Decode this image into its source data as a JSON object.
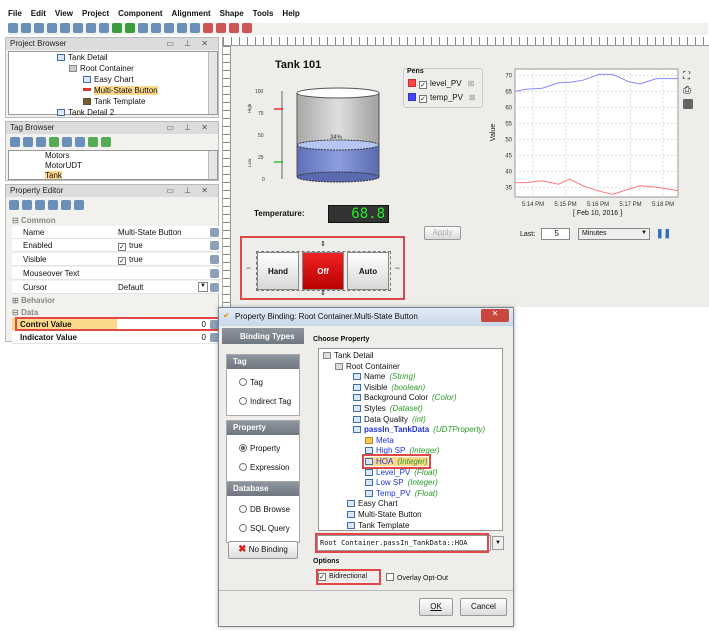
{
  "menu": [
    "File",
    "Edit",
    "View",
    "Project",
    "Component",
    "Alignment",
    "Shape",
    "Tools",
    "Help"
  ],
  "project_browser": {
    "title": "Project Browser",
    "items": [
      {
        "label": "Tank Detail"
      },
      {
        "label": "Root Container"
      },
      {
        "label": "Easy Chart"
      },
      {
        "label": "Multi-State Button",
        "selected": true
      },
      {
        "label": "Tank Template"
      },
      {
        "label": "Tank Detail 2"
      }
    ]
  },
  "tag_browser": {
    "title": "Tag Browser",
    "items": [
      {
        "label": "Motors"
      },
      {
        "label": "MotorUDT"
      },
      {
        "label": "Tank",
        "selected": true
      }
    ]
  },
  "property_editor": {
    "title": "Property Editor",
    "sections": {
      "common": "Common",
      "behavior": "Behavior",
      "data": "Data"
    },
    "rows": [
      {
        "name": "Name",
        "value": "Multi-State Button"
      },
      {
        "name": "Enabled",
        "value": "true"
      },
      {
        "name": "Visible",
        "value": "true"
      },
      {
        "name": "Mouseover Text",
        "value": ""
      },
      {
        "name": "Cursor",
        "value": "Default"
      }
    ],
    "data_rows": [
      {
        "name": "Control Value",
        "value": "0"
      },
      {
        "name": "Indicator Value",
        "value": "0"
      }
    ]
  },
  "designer": {
    "tank": {
      "title": "Tank 101",
      "level_label": "34%",
      "level_percent": 34,
      "scale": [
        "100",
        "75",
        "50",
        "25",
        "0"
      ],
      "high_label": "High",
      "low_label": "Low",
      "high_sp": 80,
      "low_sp": 20
    },
    "temperature": {
      "label": "Temperature:",
      "value": "68.8"
    },
    "apply_label": "Apply",
    "multi_state": {
      "buttons": [
        "Hand",
        "Off",
        "Auto"
      ],
      "active": "Off"
    },
    "pens": {
      "title": "Pens",
      "items": [
        {
          "name": "level_PV",
          "color": "#ff4444"
        },
        {
          "name": "temp_PV",
          "color": "#4444ff"
        }
      ]
    },
    "chart": {
      "ylabel": "Value",
      "yticks": [
        "70",
        "65",
        "60",
        "55",
        "50",
        "45",
        "40",
        "35"
      ],
      "xticks": [
        "5:14 PM",
        "5:15 PM",
        "5:16 PM",
        "5:17 PM",
        "5:18 PM"
      ],
      "date": "[ Feb 10, 2016 ]"
    },
    "last": {
      "label": "Last:",
      "value": "5",
      "unit": "Minutes"
    }
  },
  "chart_data": {
    "type": "line",
    "ylabel": "Value",
    "xlabel": "[ Feb 10, 2016 ]",
    "ylim": [
      32,
      72
    ],
    "x": [
      "5:13:10",
      "5:13:30",
      "5:14:00",
      "5:14:30",
      "5:14:50",
      "5:15:15",
      "5:15:45",
      "5:16:10",
      "5:16:40",
      "5:17:00",
      "5:17:30",
      "5:18:10"
    ],
    "series": [
      {
        "name": "temp_PV",
        "color": "#8888ff",
        "values": [
          65,
          65.7,
          66,
          67.7,
          67.8,
          68.5,
          70.3,
          70.3,
          68,
          67.3,
          69,
          69
        ]
      },
      {
        "name": "level_PV",
        "color": "#ff7777",
        "values": [
          36.5,
          36.5,
          37.1,
          36,
          37.6,
          35.5,
          33.8,
          32.8,
          34.5,
          35.5,
          35.1,
          34
        ]
      }
    ]
  },
  "dialog": {
    "title": "Property Binding: Root Container.Multi-State Button",
    "binding_types": "Binding Types",
    "groups": [
      {
        "title": "Tag",
        "options": [
          "Tag",
          "Indirect Tag"
        ]
      },
      {
        "title": "Property",
        "options": [
          "Property",
          "Expression"
        ],
        "selected": "Property"
      },
      {
        "title": "Database",
        "options": [
          "DB Browse",
          "SQL Query"
        ]
      }
    ],
    "no_binding": "No Binding",
    "choose_property": "Choose Property",
    "tree": [
      {
        "label": "Tank Detail"
      },
      {
        "label": "Root Container"
      },
      {
        "label": "Name",
        "type": "(String)"
      },
      {
        "label": "Visible",
        "type": "(boolean)"
      },
      {
        "label": "Background Color",
        "type": "(Color)"
      },
      {
        "label": "Styles",
        "type": "(Dataset)"
      },
      {
        "label": "Data Quality",
        "type": "(int)"
      },
      {
        "label": "passIn_TankData",
        "type": "(UDTProperty)"
      },
      {
        "label": "Meta"
      },
      {
        "label": "High SP",
        "type": "(Integer)"
      },
      {
        "label": "HOA",
        "type": "(Integer)"
      },
      {
        "label": "Level_PV",
        "type": "(Float)"
      },
      {
        "label": "Low SP",
        "type": "(Integer)"
      },
      {
        "label": "Temp_PV",
        "type": "(Float)"
      },
      {
        "label": "Easy Chart"
      },
      {
        "label": "Multi-State Button"
      },
      {
        "label": "Tank Template"
      }
    ],
    "path": "Root Container.passIn_TankData::HOA",
    "options_label": "Options",
    "bidirectional": "Bidirectional",
    "overlay": "Overlay Opt-Out",
    "ok": "OK",
    "cancel": "Cancel"
  }
}
